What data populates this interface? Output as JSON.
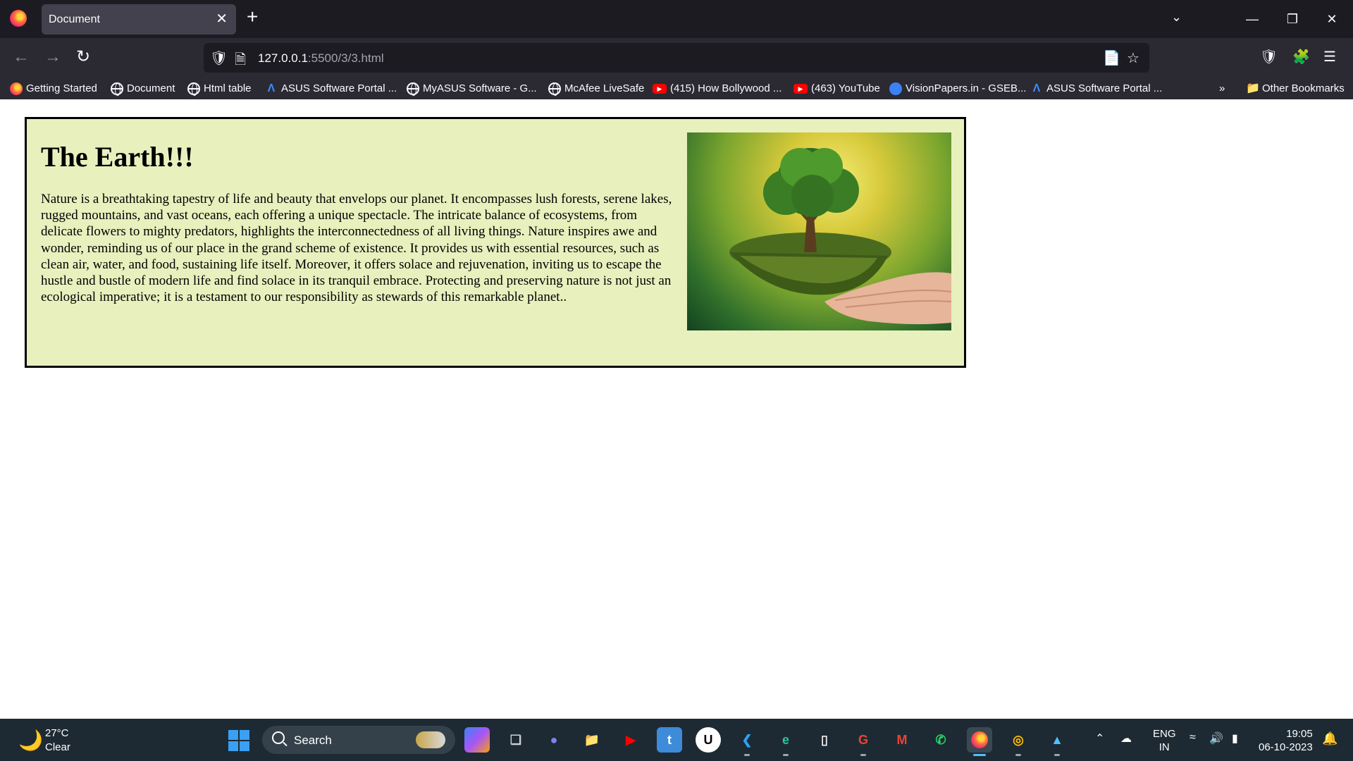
{
  "browser": {
    "tab_title": "Document",
    "tab_close": "✕",
    "new_tab": "+",
    "url_host": "127.0.0.1",
    "url_rest": ":5500/3/3.html",
    "bookmarks": [
      {
        "label": "Getting Started",
        "icon": "firefox-icon"
      },
      {
        "label": "Document",
        "icon": "globe-icon"
      },
      {
        "label": "Html table",
        "icon": "globe-icon"
      },
      {
        "label": "ASUS Software Portal ...",
        "icon": "asus-icon"
      },
      {
        "label": "MyASUS Software - G...",
        "icon": "globe-icon"
      },
      {
        "label": "McAfee LiveSafe",
        "icon": "globe-icon"
      },
      {
        "label": "(415) How Bollywood ...",
        "icon": "youtube-icon"
      },
      {
        "label": "(463) YouTube",
        "icon": "youtube-icon"
      },
      {
        "label": "VisionPapers.in - GSEB...",
        "icon": "visionpapers-icon"
      },
      {
        "label": "ASUS Software Portal ...",
        "icon": "asus-icon"
      }
    ],
    "other_bookmarks": "Other Bookmarks"
  },
  "page": {
    "heading": "The Earth!!!",
    "paragraph": "Nature is a breathtaking tapestry of life and beauty that envelops our planet. It encompasses lush forests, serene lakes, rugged mountains, and vast oceans, each offering a unique spectacle. The intricate balance of ecosystems, from delicate flowers to mighty predators, highlights the interconnectedness of all living things. Nature inspires awe and wonder, reminding us of our place in the grand scheme of existence. It provides us with essential resources, such as clean air, water, and food, sustaining life itself. Moreover, it offers solace and rejuvenation, inviting us to escape the hustle and bustle of modern life and find solace in its tranquil embrace. Protecting and preserving nature is not just an ecological imperative; it is a testament to our responsibility as stewards of this remarkable planet..",
    "image_icon": "tree-in-hands-photo"
  },
  "taskbar": {
    "temperature": "27°C",
    "weather": "Clear",
    "search_label": "Search",
    "lang_top": "ENG",
    "lang_bottom": "IN",
    "time": "19:05",
    "date": "06-10-2023",
    "apps": [
      "copilot-icon",
      "task-view-icon",
      "teams-icon",
      "file-explorer-icon",
      "youtube-icon",
      "t-app-icon",
      "u-app-icon",
      "vscode-icon",
      "edge-icon",
      "notepad-icon",
      "google-icon",
      "gmail-icon",
      "whatsapp-icon",
      "firefox-icon",
      "chrome-icon",
      "photos-icon"
    ]
  }
}
